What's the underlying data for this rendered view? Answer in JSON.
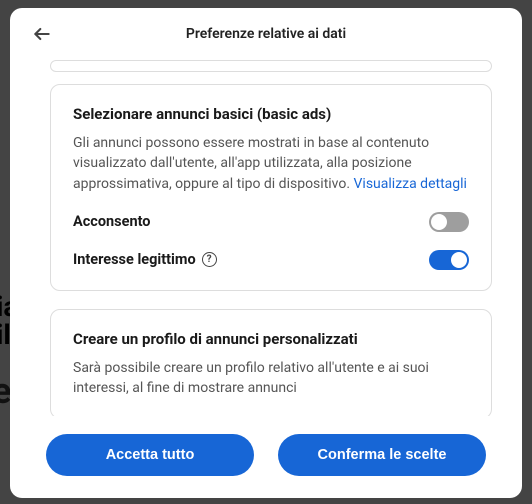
{
  "header": {
    "title": "Preferenze relative ai dati"
  },
  "cards": [
    {
      "title": "Selezionare annunci basici (basic ads)",
      "description": "Gli annunci possono essere mostrati in base al contenuto visualizzato dall'utente, all'app utilizzata, alla posizione approssimativa, oppure al tipo di dispositivo.",
      "details_link": "Visualizza dettagli",
      "consent_label": "Acconsento",
      "consent_on": false,
      "legit_label": "Interesse legittimo",
      "legit_on": true
    },
    {
      "title": "Creare un profilo di annunci personalizzati",
      "description": "Sarà possibile creare un profilo relativo all'utente e ai suoi interessi, al fine di mostrare annunci"
    }
  ],
  "footer": {
    "accept_all": "Accetta tutto",
    "confirm": "Conferma le scelte"
  },
  "colors": {
    "primary": "#1766d6"
  }
}
